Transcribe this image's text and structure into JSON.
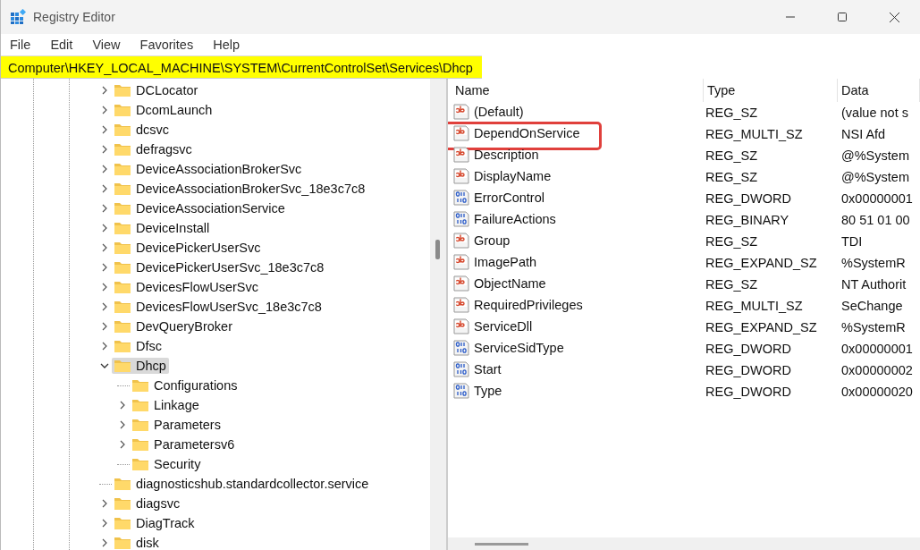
{
  "window": {
    "title": "Registry Editor"
  },
  "menu": [
    "File",
    "Edit",
    "View",
    "Favorites",
    "Help"
  ],
  "address_bar": {
    "value": "Computer\\HKEY_LOCAL_MACHINE\\SYSTEM\\CurrentControlSet\\Services\\Dhcp",
    "highlighted": true
  },
  "tree": [
    {
      "label": "DCLocator",
      "expandable": true,
      "selected": false
    },
    {
      "label": "DcomLaunch",
      "expandable": true,
      "selected": false
    },
    {
      "label": "dcsvc",
      "expandable": true,
      "selected": false
    },
    {
      "label": "defragsvc",
      "expandable": true,
      "selected": false
    },
    {
      "label": "DeviceAssociationBrokerSvc",
      "expandable": true,
      "selected": false
    },
    {
      "label": "DeviceAssociationBrokerSvc_18e3c7c8",
      "expandable": true,
      "selected": false
    },
    {
      "label": "DeviceAssociationService",
      "expandable": true,
      "selected": false
    },
    {
      "label": "DeviceInstall",
      "expandable": true,
      "selected": false
    },
    {
      "label": "DevicePickerUserSvc",
      "expandable": true,
      "selected": false
    },
    {
      "label": "DevicePickerUserSvc_18e3c7c8",
      "expandable": true,
      "selected": false
    },
    {
      "label": "DevicesFlowUserSvc",
      "expandable": true,
      "selected": false
    },
    {
      "label": "DevicesFlowUserSvc_18e3c7c8",
      "expandable": true,
      "selected": false
    },
    {
      "label": "DevQueryBroker",
      "expandable": true,
      "selected": false
    },
    {
      "label": "Dfsc",
      "expandable": true,
      "selected": false
    },
    {
      "label": "Dhcp",
      "expandable": true,
      "expanded": true,
      "selected": true,
      "children": [
        {
          "label": "Configurations",
          "expandable": false,
          "selected": false
        },
        {
          "label": "Linkage",
          "expandable": true,
          "selected": false
        },
        {
          "label": "Parameters",
          "expandable": true,
          "selected": false
        },
        {
          "label": "Parametersv6",
          "expandable": true,
          "selected": false
        },
        {
          "label": "Security",
          "expandable": false,
          "selected": false
        }
      ]
    },
    {
      "label": "diagnosticshub.standardcollector.service",
      "expandable": false,
      "selected": false
    },
    {
      "label": "diagsvc",
      "expandable": true,
      "selected": false
    },
    {
      "label": "DiagTrack",
      "expandable": true,
      "selected": false
    },
    {
      "label": "disk",
      "expandable": true,
      "selected": false
    }
  ],
  "table": {
    "columns": [
      "Name",
      "Type",
      "Data"
    ],
    "rows": [
      {
        "kind": "string",
        "name": "(Default)",
        "type": "REG_SZ",
        "data": "(value not s",
        "annotated": false
      },
      {
        "kind": "string",
        "name": "DependOnService",
        "type": "REG_MULTI_SZ",
        "data": "NSI Afd",
        "annotated": true
      },
      {
        "kind": "string",
        "name": "Description",
        "type": "REG_SZ",
        "data": "@%System",
        "annotated": false
      },
      {
        "kind": "string",
        "name": "DisplayName",
        "type": "REG_SZ",
        "data": "@%System",
        "annotated": false
      },
      {
        "kind": "binary",
        "name": "ErrorControl",
        "type": "REG_DWORD",
        "data": "0x00000001",
        "annotated": false
      },
      {
        "kind": "binary",
        "name": "FailureActions",
        "type": "REG_BINARY",
        "data": "80 51 01 00",
        "annotated": false
      },
      {
        "kind": "string",
        "name": "Group",
        "type": "REG_SZ",
        "data": "TDI",
        "annotated": false
      },
      {
        "kind": "string",
        "name": "ImagePath",
        "type": "REG_EXPAND_SZ",
        "data": "%SystemR",
        "annotated": false
      },
      {
        "kind": "string",
        "name": "ObjectName",
        "type": "REG_SZ",
        "data": "NT Authorit",
        "annotated": false
      },
      {
        "kind": "string",
        "name": "RequiredPrivileges",
        "type": "REG_MULTI_SZ",
        "data": "SeChange",
        "annotated": false
      },
      {
        "kind": "string",
        "name": "ServiceDll",
        "type": "REG_EXPAND_SZ",
        "data": "%SystemR",
        "annotated": false
      },
      {
        "kind": "binary",
        "name": "ServiceSidType",
        "type": "REG_DWORD",
        "data": "0x00000001",
        "annotated": false
      },
      {
        "kind": "binary",
        "name": "Start",
        "type": "REG_DWORD",
        "data": "0x00000002",
        "annotated": false
      },
      {
        "kind": "binary",
        "name": "Type",
        "type": "REG_DWORD",
        "data": "0x00000020",
        "annotated": false
      }
    ]
  }
}
